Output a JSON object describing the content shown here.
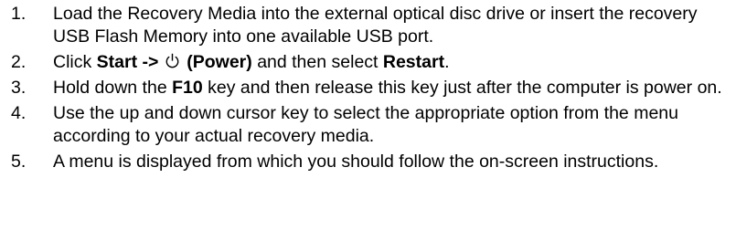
{
  "steps": [
    {
      "number": "1.",
      "text": "Load the Recovery Media into the external optical disc drive or insert the recovery USB Flash Memory into one available USB port."
    },
    {
      "number": "2.",
      "click": "Click",
      "start": "Start ->",
      "power": "(Power)",
      "then_select": "and then select",
      "restart": "Restart",
      "end": ".",
      "icon": "power-icon"
    },
    {
      "number": "3.",
      "hold": "Hold down the",
      "key": "F10",
      "rest": "key and then release this key just after the computer is power on."
    },
    {
      "number": "4.",
      "text": "Use the up and down cursor key to select the appropriate option from the menu according to your actual recovery media."
    },
    {
      "number": "5.",
      "text": "A menu is displayed from which you should follow the on-screen instructions."
    }
  ]
}
